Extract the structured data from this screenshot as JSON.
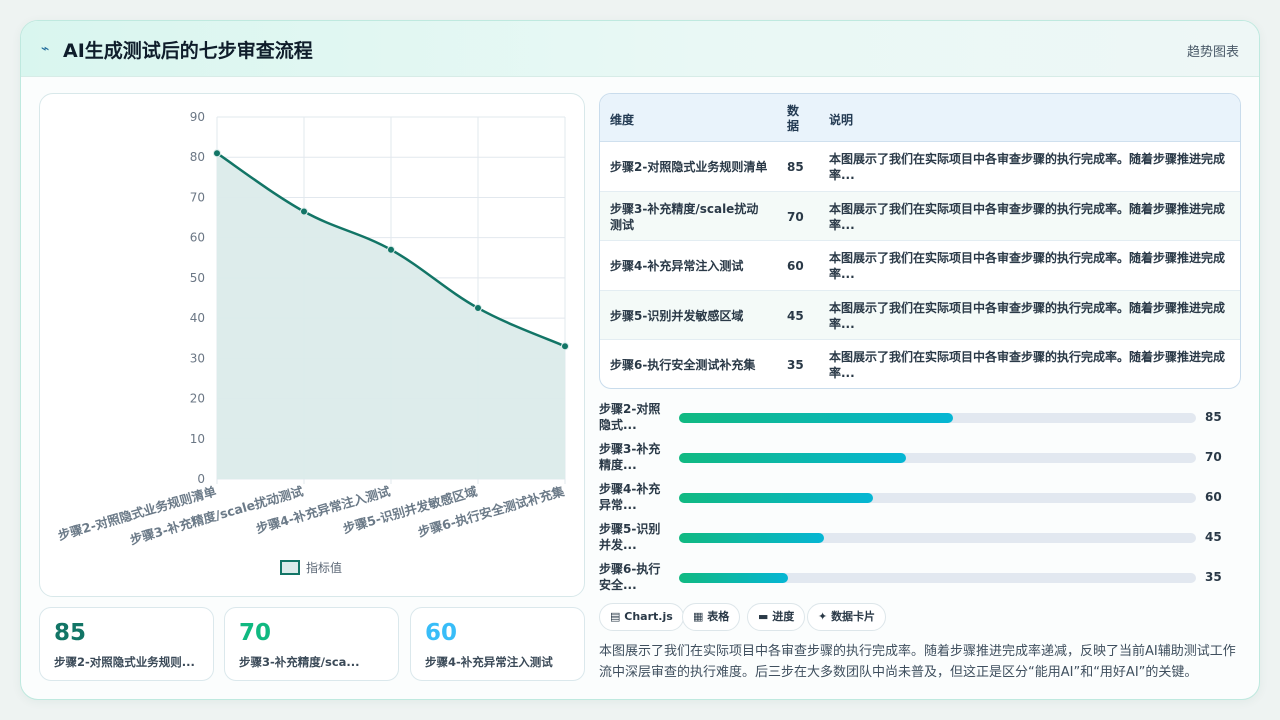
{
  "header": {
    "icon": "chart-spark-icon",
    "title": "AI生成测试后的七步审查流程",
    "tag": "趋势图表"
  },
  "colors": {
    "line": "#127566",
    "area": "#dbebea",
    "kpi1": "#127566",
    "kpi2": "#10b981",
    "kpi3": "#38bdf8"
  },
  "chart_data": {
    "type": "line",
    "categories": [
      "步骤2-对照隐式业务规则清单",
      "步骤3-补充精度/scale扰动测试",
      "步骤4-补充异常注入测试",
      "步骤5-识别并发敏感区域",
      "步骤6-执行安全测试补充集"
    ],
    "series": [
      {
        "name": "指标值",
        "values": [
          81,
          66.5,
          57,
          42.5,
          33
        ]
      }
    ],
    "ylim": [
      0,
      90
    ],
    "yticks": [
      0,
      10,
      20,
      30,
      40,
      50,
      60,
      70,
      80,
      90
    ],
    "grid": true,
    "legend": "bottom",
    "fill": "area"
  },
  "kpis": [
    {
      "value": "85",
      "label": "步骤2-对照隐式业务规则...",
      "color": "#127566"
    },
    {
      "value": "70",
      "label": "步骤3-补充精度/sca...",
      "color": "#10b981"
    },
    {
      "value": "60",
      "label": "步骤4-补充异常注入测试",
      "color": "#38bdf8"
    }
  ],
  "table": {
    "headers": [
      "维度",
      "数据",
      "说明"
    ],
    "rows": [
      {
        "dim": "步骤2-对照隐式业务规则清单",
        "val": "85",
        "note": "本图展示了我们在实际项目中各审查步骤的执行完成率。随着步骤推进完成率..."
      },
      {
        "dim": "步骤3-补充精度/scale扰动测试",
        "val": "70",
        "note": "本图展示了我们在实际项目中各审查步骤的执行完成率。随着步骤推进完成率..."
      },
      {
        "dim": "步骤4-补充异常注入测试",
        "val": "60",
        "note": "本图展示了我们在实际项目中各审查步骤的执行完成率。随着步骤推进完成率..."
      },
      {
        "dim": "步骤5-识别并发敏感区域",
        "val": "45",
        "note": "本图展示了我们在实际项目中各审查步骤的执行完成率。随着步骤推进完成率..."
      },
      {
        "dim": "步骤6-执行安全测试补充集",
        "val": "35",
        "note": "本图展示了我们在实际项目中各审查步骤的执行完成率。随着步骤推进完成率..."
      }
    ]
  },
  "progress": [
    {
      "label": "步骤2-对照隐式...",
      "value": "85",
      "fill": 0.53
    },
    {
      "label": "步骤3-补充精度...",
      "value": "70",
      "fill": 0.44
    },
    {
      "label": "步骤4-补充异常...",
      "value": "60",
      "fill": 0.375
    },
    {
      "label": "步骤5-识别并发...",
      "value": "45",
      "fill": 0.28
    },
    {
      "label": "步骤6-执行安全...",
      "value": "35",
      "fill": 0.21
    }
  ],
  "chips": [
    {
      "icon": "chart-icon",
      "glyph": "▤",
      "label": "Chart.js"
    },
    {
      "icon": "table-icon",
      "glyph": "▦",
      "label": "表格"
    },
    {
      "icon": "progress-icon",
      "glyph": "▬",
      "label": "进度"
    },
    {
      "icon": "card-icon",
      "glyph": "✦",
      "label": "数据卡片"
    }
  ],
  "description": "本图展示了我们在实际项目中各审查步骤的执行完成率。随着步骤推进完成率递减，反映了当前AI辅助测试工作流中深层审查的执行难度。后三步在大多数团队中尚未普及，但这正是区分“能用AI”和“用好AI”的关键。"
}
